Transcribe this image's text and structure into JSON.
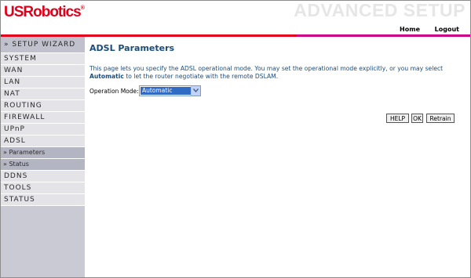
{
  "header": {
    "logo": "USRobotics",
    "logo_mark": "®",
    "title": "ADVANCED SETUP"
  },
  "topnav": {
    "home": "Home",
    "logout": "Logout"
  },
  "sidebar": {
    "items": [
      {
        "label": "» SETUP WIZARD"
      },
      {
        "label": "SYSTEM"
      },
      {
        "label": "WAN"
      },
      {
        "label": "LAN"
      },
      {
        "label": "NAT"
      },
      {
        "label": "ROUTING"
      },
      {
        "label": "FIREWALL"
      },
      {
        "label": "UPnP"
      },
      {
        "label": "ADSL"
      },
      {
        "label": "» Parameters"
      },
      {
        "label": "» Status"
      },
      {
        "label": "DDNS"
      },
      {
        "label": "TOOLS"
      },
      {
        "label": "STATUS"
      }
    ]
  },
  "main": {
    "title": "ADSL Parameters",
    "desc_part1": "This page lets you specify the ADSL operational mode. You may set the operational mode explicitly, or you may select",
    "desc_bold": "Automatic",
    "desc_part2": "to let the router negotiate with the remote DSLAM.",
    "mode_label": "Operation Mode:",
    "mode_value": "Automatic"
  },
  "buttons": {
    "help": "HELP",
    "ok": "OK",
    "retrain": "Retrain"
  },
  "colors": {
    "brand_red": "#e3001b",
    "accent_magenta": "#cc0088",
    "title_blue": "#1a4d7a"
  }
}
